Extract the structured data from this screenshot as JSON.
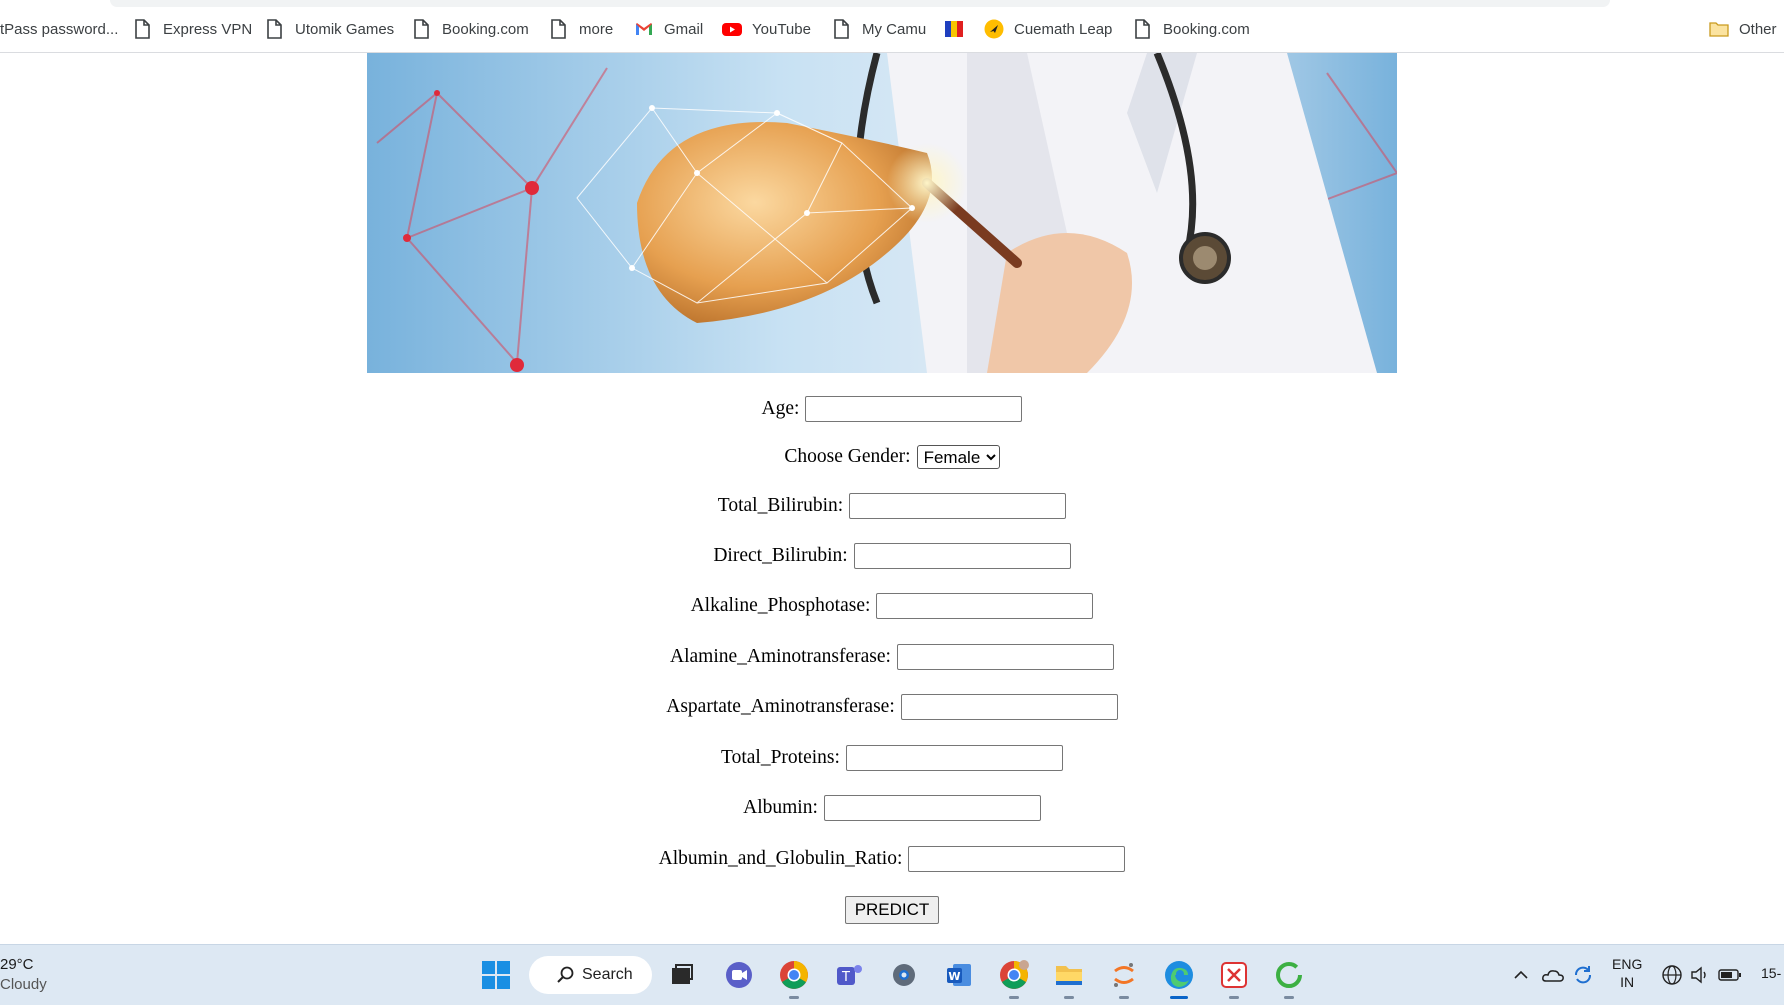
{
  "bookmarks": {
    "items": [
      {
        "label": "tPass password...",
        "icon": "none"
      },
      {
        "label": "Express VPN",
        "icon": "page-icon"
      },
      {
        "label": "Utomik Games",
        "icon": "page-icon"
      },
      {
        "label": "Booking.com",
        "icon": "page-icon"
      },
      {
        "label": "more",
        "icon": "page-icon"
      },
      {
        "label": "Gmail",
        "icon": "gmail-icon"
      },
      {
        "label": "YouTube",
        "icon": "youtube-icon"
      },
      {
        "label": "My Camu",
        "icon": "page-icon"
      },
      {
        "label": "",
        "icon": "camu-flag-icon"
      },
      {
        "label": "Cuemath Leap",
        "icon": "cuemath-icon"
      },
      {
        "label": "Booking.com",
        "icon": "page-icon"
      }
    ],
    "other_label": "Other"
  },
  "form": {
    "fields": [
      {
        "label": "Age:",
        "value": ""
      },
      {
        "label": "Total_Bilirubin:",
        "value": ""
      },
      {
        "label": "Direct_Bilirubin:",
        "value": ""
      },
      {
        "label": "Alkaline_Phosphotase:",
        "value": ""
      },
      {
        "label": "Alamine_Aminotransferase:",
        "value": ""
      },
      {
        "label": "Aspartate_Aminotransferase:",
        "value": ""
      },
      {
        "label": "Total_Proteins:",
        "value": ""
      },
      {
        "label": "Albumin:",
        "value": ""
      },
      {
        "label": "Albumin_and_Globulin_Ratio:",
        "value": ""
      }
    ],
    "gender": {
      "label": "Choose Gender:",
      "selected": "Female"
    },
    "predict_label": "PREDICT"
  },
  "taskbar": {
    "temperature": "29°C",
    "condition": "Cloudy",
    "search_label": "Search",
    "language": "ENG",
    "region": "IN",
    "clock": "15-"
  },
  "colors": {
    "hero_sky": "#7db3da",
    "taskbar_bg": "#dde8f3",
    "accent": "#0a64c8"
  }
}
